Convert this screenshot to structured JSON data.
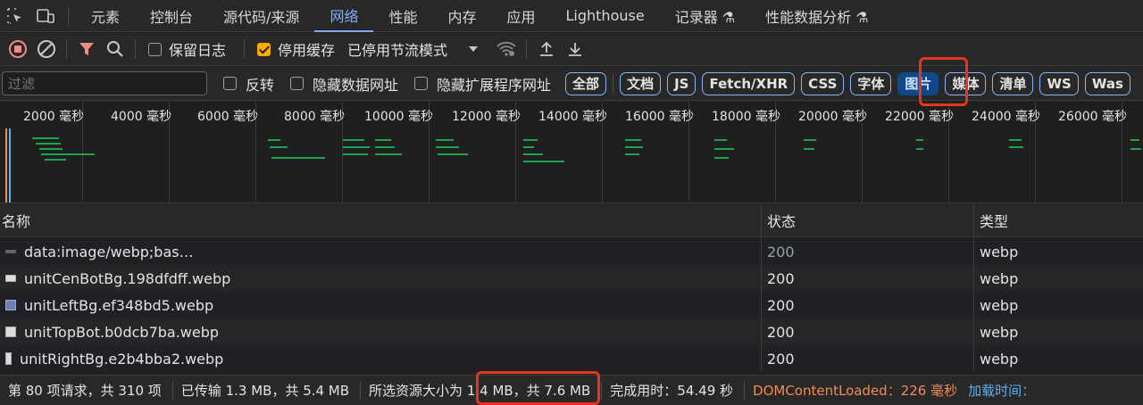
{
  "tabs": [
    "元素",
    "控制台",
    "源代码/来源",
    "网络",
    "性能",
    "内存",
    "应用",
    "Lighthouse",
    "记录器 ⚗",
    "性能数据分析 ⚗"
  ],
  "active_tab": "网络",
  "toolbar": {
    "preserve_log": "保留日志",
    "disable_cache": "停用缓存",
    "throttling": "已停用节流模式"
  },
  "filter": {
    "placeholder": "过滤",
    "invert": "反转",
    "hide_data_urls": "隐藏数据网址",
    "hide_extension_urls": "隐藏扩展程序网址",
    "types": [
      "全部",
      "文档",
      "JS",
      "Fetch/XHR",
      "CSS",
      "字体",
      "图片",
      "媒体",
      "清单",
      "WS",
      "Was"
    ],
    "selected_type": "图片"
  },
  "overview": {
    "ticks": [
      "2000 毫秒",
      "4000 毫秒",
      "6000 毫秒",
      "8000 毫秒",
      "10000 毫秒",
      "12000 毫秒",
      "14000 毫秒",
      "16000 毫秒",
      "18000 毫秒",
      "20000 毫秒",
      "22000 毫秒",
      "24000 毫秒",
      "26000 毫秒"
    ]
  },
  "table": {
    "columns": [
      "名称",
      "状态",
      "类型"
    ],
    "rows": [
      {
        "name": "data:image/webp;bas…",
        "status": "200",
        "type": "webp"
      },
      {
        "name": "unitCenBotBg.198dfdff.webp",
        "status": "200",
        "type": "webp"
      },
      {
        "name": "unitLeftBg.ef348bd5.webp",
        "status": "200",
        "type": "webp"
      },
      {
        "name": "unitTopBot.b0dcb7ba.webp",
        "status": "200",
        "type": "webp"
      },
      {
        "name": "unitRightBg.e2b4bba2.webp",
        "status": "200",
        "type": "webp"
      }
    ]
  },
  "statusbar": {
    "requests": "第 80 项请求，共 310 项",
    "transferred": "已传输 1.3 MB，共 5.4 MB",
    "resources": "所选资源大小为 1.4 MB，共 7.6 MB",
    "finish": "完成用时：54.49 秒",
    "dcl": "DOMContentLoaded：226 毫秒",
    "load": "加载时间："
  },
  "colors": {
    "accent": "#7cacf8",
    "record": "#f28b82",
    "annotation": "#e8331f",
    "dcl": "#f28b54",
    "load": "#5bb2f7"
  }
}
